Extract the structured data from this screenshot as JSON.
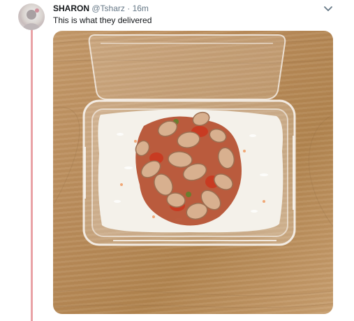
{
  "tweet": {
    "name": "SHARON",
    "handle": "@Tsharz",
    "separator": "·",
    "time": "16m",
    "text": "This is what they delivered"
  },
  "icons": {
    "menu": "chevron-down-icon",
    "avatar": "user-avatar"
  },
  "colors": {
    "thread_line": "#e9a2a6",
    "name_text": "#14171a",
    "secondary_text": "#657786"
  }
}
